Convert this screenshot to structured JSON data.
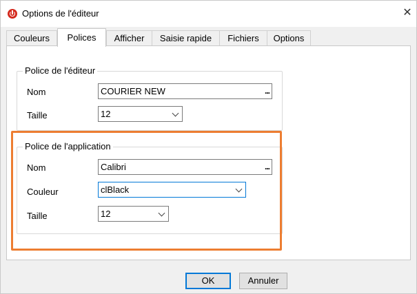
{
  "window": {
    "title": "Options de l'éditeur",
    "close_glyph": "✕",
    "app_icon": "power-icon"
  },
  "tabs": [
    {
      "label": "Couleurs",
      "active": false
    },
    {
      "label": "Polices",
      "active": true
    },
    {
      "label": "Afficher",
      "active": false
    },
    {
      "label": "Saisie rapide",
      "active": false
    },
    {
      "label": "Fichiers",
      "active": false
    },
    {
      "label": "Options",
      "active": false
    }
  ],
  "editor_font": {
    "legend": "Police de l'éditeur",
    "name_label": "Nom",
    "name_value": "COURIER NEW",
    "browse_label": "...",
    "size_label": "Taille",
    "size_value": "12"
  },
  "app_font": {
    "legend": "Police de l'application",
    "name_label": "Nom",
    "name_value": "Calibri",
    "browse_label": "...",
    "color_label": "Couleur",
    "color_value": "clBlack",
    "size_label": "Taille",
    "size_value": "12"
  },
  "buttons": {
    "ok": "OK",
    "cancel": "Annuler"
  },
  "colors": {
    "highlight": "#ed7d31",
    "focus": "#0078d7",
    "app_icon": "#d42a1e"
  }
}
